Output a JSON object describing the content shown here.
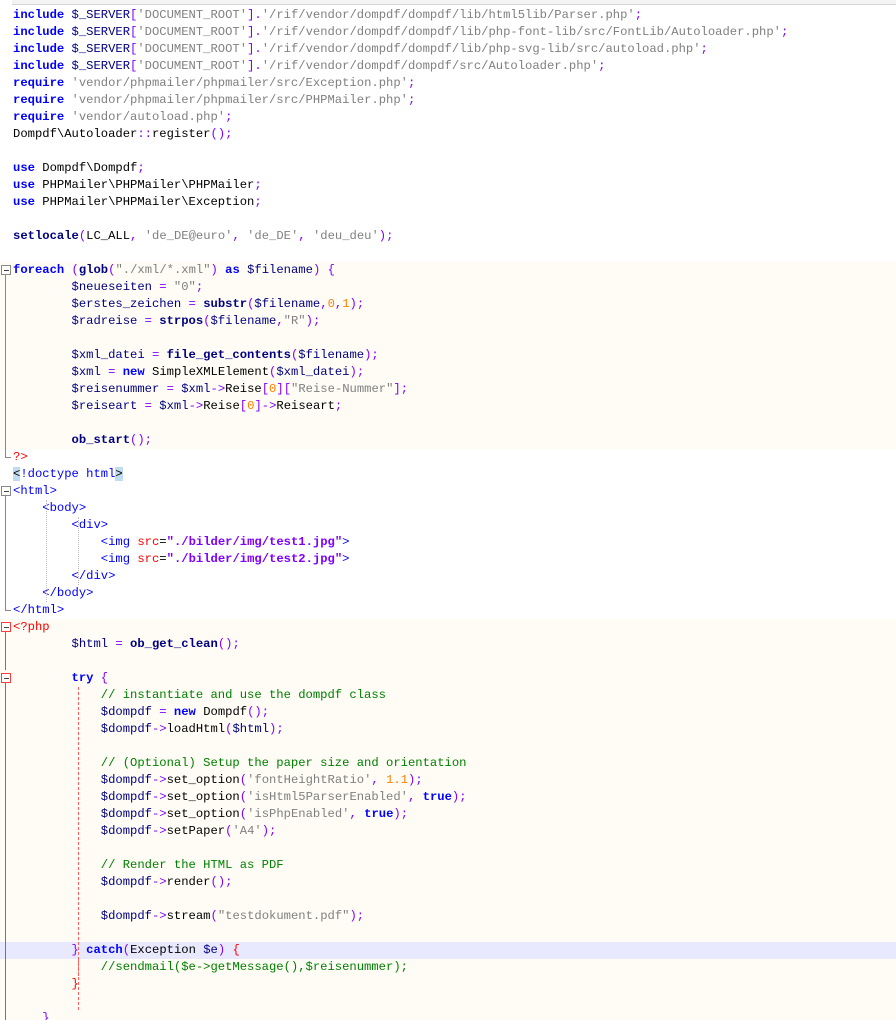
{
  "editor": {
    "lines": [
      [
        [
          "kw",
          "include "
        ],
        [
          "var",
          "$_SERVER"
        ],
        [
          "op",
          "["
        ],
        [
          "str",
          "'DOCUMENT_ROOT'"
        ],
        [
          "op",
          "]."
        ],
        [
          "str",
          "'/rif/vendor/dompdf/dompdf/lib/html5lib/Parser.php'"
        ],
        [
          "op",
          ";"
        ]
      ],
      [
        [
          "kw",
          "include "
        ],
        [
          "var",
          "$_SERVER"
        ],
        [
          "op",
          "["
        ],
        [
          "str",
          "'DOCUMENT_ROOT'"
        ],
        [
          "op",
          "]."
        ],
        [
          "str",
          "'/rif/vendor/dompdf/dompdf/lib/php-font-lib/src/FontLib/Autoloader.php'"
        ],
        [
          "op",
          ";"
        ]
      ],
      [
        [
          "kw",
          "include "
        ],
        [
          "var",
          "$_SERVER"
        ],
        [
          "op",
          "["
        ],
        [
          "str",
          "'DOCUMENT_ROOT'"
        ],
        [
          "op",
          "]."
        ],
        [
          "str",
          "'/rif/vendor/dompdf/dompdf/lib/php-svg-lib/src/autoload.php'"
        ],
        [
          "op",
          ";"
        ]
      ],
      [
        [
          "kw",
          "include "
        ],
        [
          "var",
          "$_SERVER"
        ],
        [
          "op",
          "["
        ],
        [
          "str",
          "'DOCUMENT_ROOT'"
        ],
        [
          "op",
          "]."
        ],
        [
          "str",
          "'/rif/vendor/dompdf/dompdf/src/Autoloader.php'"
        ],
        [
          "op",
          ";"
        ]
      ],
      [
        [
          "kw",
          "require "
        ],
        [
          "str",
          "'vendor/phpmailer/phpmailer/src/Exception.php'"
        ],
        [
          "op",
          ";"
        ]
      ],
      [
        [
          "kw",
          "require "
        ],
        [
          "str",
          "'vendor/phpmailer/phpmailer/src/PHPMailer.php'"
        ],
        [
          "op",
          ";"
        ]
      ],
      [
        [
          "kw",
          "require "
        ],
        [
          "str",
          "'vendor/autoload.php'"
        ],
        [
          "op",
          ";"
        ]
      ],
      [
        [
          "txt",
          "Dompdf\\Autoloader"
        ],
        [
          "op",
          "::"
        ],
        [
          "txt",
          "register"
        ],
        [
          "op",
          "();"
        ]
      ],
      [],
      [
        [
          "kw",
          "use "
        ],
        [
          "txt",
          "Dompdf\\Dompdf"
        ],
        [
          "op",
          ";"
        ]
      ],
      [
        [
          "kw",
          "use "
        ],
        [
          "txt",
          "PHPMailer\\PHPMailer\\PHPMailer"
        ],
        [
          "op",
          ";"
        ]
      ],
      [
        [
          "kw",
          "use "
        ],
        [
          "txt",
          "PHPMailer\\PHPMailer\\Exception"
        ],
        [
          "op",
          ";"
        ]
      ],
      [],
      [
        [
          "fn",
          "setlocale"
        ],
        [
          "op",
          "("
        ],
        [
          "txt",
          "LC_ALL"
        ],
        [
          "op",
          ", "
        ],
        [
          "str",
          "'de_DE@euro'"
        ],
        [
          "op",
          ", "
        ],
        [
          "str",
          "'de_DE'"
        ],
        [
          "op",
          ", "
        ],
        [
          "str",
          "'deu_deu'"
        ],
        [
          "op",
          ");"
        ]
      ],
      [],
      [
        [
          "kw",
          "foreach "
        ],
        [
          "op",
          "("
        ],
        [
          "fn",
          "glob"
        ],
        [
          "op",
          "("
        ],
        [
          "str2",
          "\"./xml/*.xml\""
        ],
        [
          "op",
          ") "
        ],
        [
          "kw",
          "as "
        ],
        [
          "var",
          "$filename"
        ],
        [
          "op",
          ") {"
        ]
      ],
      [
        [
          "txt",
          "        "
        ],
        [
          "var",
          "$neueseiten"
        ],
        [
          "op",
          " = "
        ],
        [
          "str2",
          "\"0\""
        ],
        [
          "op",
          ";"
        ]
      ],
      [
        [
          "txt",
          "        "
        ],
        [
          "var",
          "$erstes_zeichen"
        ],
        [
          "op",
          " = "
        ],
        [
          "fn",
          "substr"
        ],
        [
          "op",
          "("
        ],
        [
          "var",
          "$filename"
        ],
        [
          "op",
          ","
        ],
        [
          "num",
          "0"
        ],
        [
          "op",
          ","
        ],
        [
          "num",
          "1"
        ],
        [
          "op",
          ");"
        ]
      ],
      [
        [
          "txt",
          "        "
        ],
        [
          "var",
          "$radreise"
        ],
        [
          "op",
          " = "
        ],
        [
          "fn",
          "strpos"
        ],
        [
          "op",
          "("
        ],
        [
          "var",
          "$filename"
        ],
        [
          "op",
          ","
        ],
        [
          "str2",
          "\"R\""
        ],
        [
          "op",
          ");"
        ]
      ],
      [],
      [
        [
          "txt",
          "        "
        ],
        [
          "var",
          "$xml_datei"
        ],
        [
          "op",
          " = "
        ],
        [
          "fn",
          "file_get_contents"
        ],
        [
          "op",
          "("
        ],
        [
          "var",
          "$filename"
        ],
        [
          "op",
          ");"
        ]
      ],
      [
        [
          "txt",
          "        "
        ],
        [
          "var",
          "$xml"
        ],
        [
          "op",
          " = "
        ],
        [
          "kw",
          "new "
        ],
        [
          "txt",
          "SimpleXMLElement"
        ],
        [
          "op",
          "("
        ],
        [
          "var",
          "$xml_datei"
        ],
        [
          "op",
          ");"
        ]
      ],
      [
        [
          "txt",
          "        "
        ],
        [
          "var",
          "$reisenummer"
        ],
        [
          "op",
          " = "
        ],
        [
          "var",
          "$xml"
        ],
        [
          "op",
          "->"
        ],
        [
          "txt",
          "Reise"
        ],
        [
          "op",
          "["
        ],
        [
          "num",
          "0"
        ],
        [
          "op",
          "]["
        ],
        [
          "str2",
          "\"Reise-Nummer\""
        ],
        [
          "op",
          "];"
        ]
      ],
      [
        [
          "txt",
          "        "
        ],
        [
          "var",
          "$reiseart"
        ],
        [
          "op",
          " = "
        ],
        [
          "var",
          "$xml"
        ],
        [
          "op",
          "->"
        ],
        [
          "txt",
          "Reise"
        ],
        [
          "op",
          "["
        ],
        [
          "num",
          "0"
        ],
        [
          "op",
          "]->"
        ],
        [
          "txt",
          "Reiseart"
        ],
        [
          "op",
          ";"
        ]
      ],
      [],
      [
        [
          "txt",
          "        "
        ],
        [
          "fn",
          "ob_start"
        ],
        [
          "op",
          "();"
        ]
      ],
      [
        [
          "php",
          "?>"
        ]
      ],
      [
        [
          "hl",
          "<"
        ],
        [
          "tag",
          "!doctype html"
        ],
        [
          "hl",
          ">"
        ]
      ],
      [
        [
          "tag",
          "<html>"
        ]
      ],
      [
        [
          "txt",
          "    "
        ],
        [
          "tag",
          "<body>"
        ]
      ],
      [
        [
          "txt",
          "        "
        ],
        [
          "tag",
          "<div>"
        ]
      ],
      [
        [
          "txt",
          "            "
        ],
        [
          "tag",
          "<img "
        ],
        [
          "attr",
          "src"
        ],
        [
          "txt",
          "="
        ],
        [
          "aval",
          "\"./bilder/img/test1.jpg\""
        ],
        [
          "tag",
          ">"
        ]
      ],
      [
        [
          "txt",
          "            "
        ],
        [
          "tag",
          "<img "
        ],
        [
          "attr",
          "src"
        ],
        [
          "txt",
          "="
        ],
        [
          "aval",
          "\"./bilder/img/test2.jpg\""
        ],
        [
          "tag",
          ">"
        ]
      ],
      [
        [
          "txt",
          "        "
        ],
        [
          "tag",
          "</div>"
        ]
      ],
      [
        [
          "txt",
          "    "
        ],
        [
          "tag",
          "</body>"
        ]
      ],
      [
        [
          "tag",
          "</html>"
        ]
      ],
      [
        [
          "php",
          "<?php"
        ]
      ],
      [
        [
          "txt",
          "        "
        ],
        [
          "var",
          "$html"
        ],
        [
          "op",
          " = "
        ],
        [
          "fn",
          "ob_get_clean"
        ],
        [
          "op",
          "();"
        ]
      ],
      [],
      [
        [
          "txt",
          "        "
        ],
        [
          "kw",
          "try "
        ],
        [
          "op",
          "{"
        ]
      ],
      [
        [
          "txt",
          "            "
        ],
        [
          "cm",
          "// instantiate and use the dompdf class"
        ]
      ],
      [
        [
          "txt",
          "            "
        ],
        [
          "var",
          "$dompdf"
        ],
        [
          "op",
          " = "
        ],
        [
          "kw",
          "new "
        ],
        [
          "txt",
          "Dompdf"
        ],
        [
          "op",
          "();"
        ]
      ],
      [
        [
          "txt",
          "            "
        ],
        [
          "var",
          "$dompdf"
        ],
        [
          "op",
          "->"
        ],
        [
          "txt",
          "loadHtml"
        ],
        [
          "op",
          "("
        ],
        [
          "var",
          "$html"
        ],
        [
          "op",
          ");"
        ]
      ],
      [],
      [
        [
          "txt",
          "            "
        ],
        [
          "cm",
          "// (Optional) Setup the paper size and orientation"
        ]
      ],
      [
        [
          "txt",
          "            "
        ],
        [
          "var",
          "$dompdf"
        ],
        [
          "op",
          "->"
        ],
        [
          "txt",
          "set_option"
        ],
        [
          "op",
          "("
        ],
        [
          "str",
          "'fontHeightRatio'"
        ],
        [
          "op",
          ", "
        ],
        [
          "num",
          "1.1"
        ],
        [
          "op",
          ");"
        ]
      ],
      [
        [
          "txt",
          "            "
        ],
        [
          "var",
          "$dompdf"
        ],
        [
          "op",
          "->"
        ],
        [
          "txt",
          "set_option"
        ],
        [
          "op",
          "("
        ],
        [
          "str",
          "'isHtml5ParserEnabled'"
        ],
        [
          "op",
          ", "
        ],
        [
          "kw",
          "true"
        ],
        [
          "op",
          ");"
        ]
      ],
      [
        [
          "txt",
          "            "
        ],
        [
          "var",
          "$dompdf"
        ],
        [
          "op",
          "->"
        ],
        [
          "txt",
          "set_option"
        ],
        [
          "op",
          "("
        ],
        [
          "str",
          "'isPhpEnabled'"
        ],
        [
          "op",
          ", "
        ],
        [
          "kw",
          "true"
        ],
        [
          "op",
          ");"
        ]
      ],
      [
        [
          "txt",
          "            "
        ],
        [
          "var",
          "$dompdf"
        ],
        [
          "op",
          "->"
        ],
        [
          "txt",
          "setPaper"
        ],
        [
          "op",
          "("
        ],
        [
          "str",
          "'A4'"
        ],
        [
          "op",
          ");"
        ]
      ],
      [],
      [
        [
          "txt",
          "            "
        ],
        [
          "cm",
          "// Render the HTML as PDF"
        ]
      ],
      [
        [
          "txt",
          "            "
        ],
        [
          "var",
          "$dompdf"
        ],
        [
          "op",
          "->"
        ],
        [
          "txt",
          "render"
        ],
        [
          "op",
          "();"
        ]
      ],
      [],
      [
        [
          "txt",
          "            "
        ],
        [
          "var",
          "$dompdf"
        ],
        [
          "op",
          "->"
        ],
        [
          "txt",
          "stream"
        ],
        [
          "op",
          "("
        ],
        [
          "str2",
          "\"testdokument.pdf\""
        ],
        [
          "op",
          ");"
        ]
      ],
      [],
      [
        [
          "txt",
          "        "
        ],
        [
          "op",
          "} "
        ],
        [
          "kw",
          "catch"
        ],
        [
          "op",
          "("
        ],
        [
          "txt",
          "Exception "
        ],
        [
          "var",
          "$e"
        ],
        [
          "op",
          ") "
        ],
        [
          "php",
          "{"
        ]
      ],
      [
        [
          "txt",
          "            "
        ],
        [
          "cm",
          "//sendmail($e->getMessage(),$reisenummer);"
        ]
      ],
      [
        [
          "txt",
          "        "
        ],
        [
          "php",
          "}"
        ]
      ],
      [],
      [
        [
          "txt",
          "    "
        ],
        [
          "op",
          "}"
        ]
      ]
    ]
  }
}
